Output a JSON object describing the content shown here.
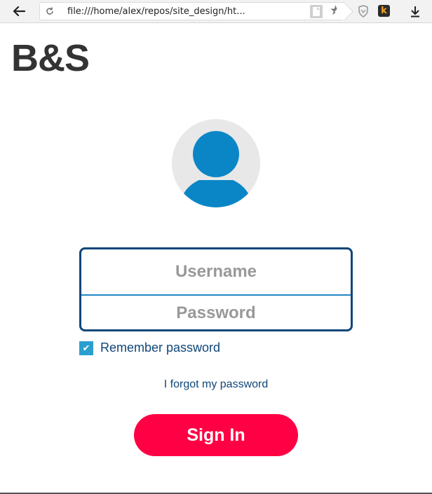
{
  "browser": {
    "url": "file:///home/alex/repos/site_design/ht...",
    "extension_letter": "k",
    "icons": [
      "back-arrow-icon",
      "reload-icon",
      "page-icon",
      "star-icon",
      "shield-icon",
      "extension-icon",
      "download-icon"
    ]
  },
  "page": {
    "logo": "B&S",
    "username_placeholder": "Username",
    "password_placeholder": "Password",
    "remember_label": "Remember password",
    "remember_checked": true,
    "checkbox_glyph": "✔",
    "forgot_link": "I forgot my password",
    "signin_label": "Sign In"
  },
  "colors": {
    "accent_navy": "#0f4679",
    "accent_blue": "#0a86c6",
    "signin_red": "#ff0044",
    "checkbox_blue": "#2a9fcf"
  }
}
